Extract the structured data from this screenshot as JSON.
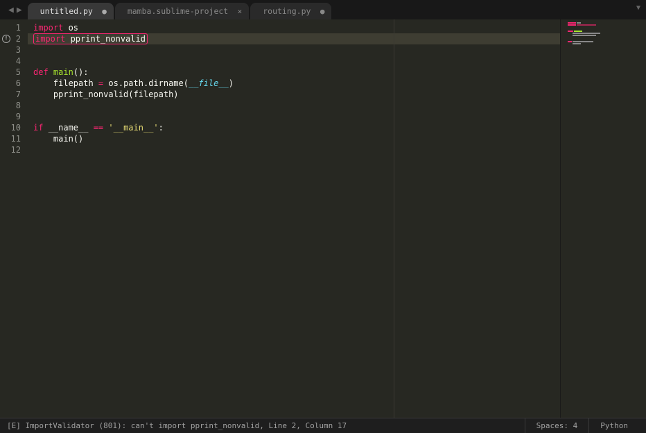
{
  "tabs": [
    {
      "label": "untitled.py",
      "indicator": "●",
      "active": true
    },
    {
      "label": "mamba.sublime-project",
      "indicator": "×",
      "active": false
    },
    {
      "label": "routing.py",
      "indicator": "●",
      "active": false
    }
  ],
  "gutter": {
    "lines": [
      "1",
      "2",
      "3",
      "4",
      "5",
      "6",
      "7",
      "8",
      "9",
      "10",
      "11",
      "12"
    ]
  },
  "code": {
    "l1_kw": "import",
    "l1_mod": " os",
    "l2_kw": "import",
    "l2_mod": " pprint_nonvalid",
    "l5_kw": "def",
    "l5_fn": " main",
    "l5_paren": "():",
    "l6_indent": "    ",
    "l6_var": "filepath",
    "l6_eq": " = ",
    "l6_call": "os.path.dirname(",
    "l6_dunder": "__file__",
    "l6_close": ")",
    "l7_indent": "    ",
    "l7_call": "pprint_nonvalid(filepath)",
    "l10_kw": "if",
    "l10_sp": " ",
    "l10_name": "__name__",
    "l10_eq": " == ",
    "l10_str": "'__main__'",
    "l10_colon": ":",
    "l11_indent": "    ",
    "l11_call": "main()"
  },
  "status": {
    "error": "[E] ImportValidator (801): can't import pprint_nonvalid, Line 2, Column 17",
    "spaces": "Spaces: 4",
    "language": "Python"
  }
}
